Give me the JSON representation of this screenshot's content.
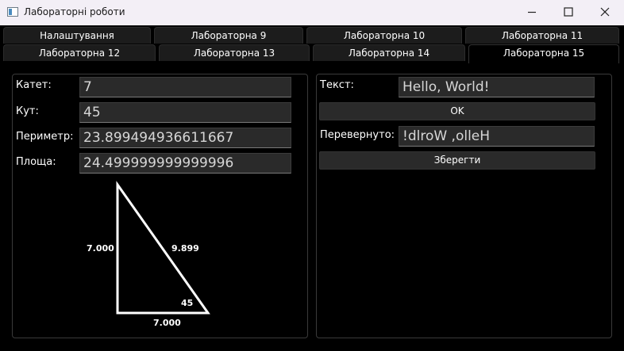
{
  "window": {
    "title": "Лабораторні роботи"
  },
  "tabs": {
    "row1": [
      "Налаштування",
      "Лабораторна 9",
      "Лабораторна 10",
      "Лабораторна 11"
    ],
    "row2": [
      "Лабораторна 12",
      "Лабораторна 13",
      "Лабораторна 14",
      "Лабораторна 15"
    ],
    "active": "Лабораторна 15"
  },
  "left": {
    "leg_label": "Катет:",
    "leg_value": "7",
    "angle_label": "Кут:",
    "angle_value": "45",
    "perimeter_label": "Периметр:",
    "perimeter_value": "23.899494936611667",
    "area_label": "Площа:",
    "area_value": "24.499999999999996",
    "triangle": {
      "left_side": "7.000",
      "hypotenuse": "9.899",
      "bottom_side": "7.000",
      "angle": "45"
    }
  },
  "right": {
    "text_label": "Текст:",
    "text_value": "Hello, World!",
    "ok_label": "OK",
    "reversed_label": "Перевернуто:",
    "reversed_value": "!dlroW ,olleH",
    "save_label": "Зберегти"
  }
}
